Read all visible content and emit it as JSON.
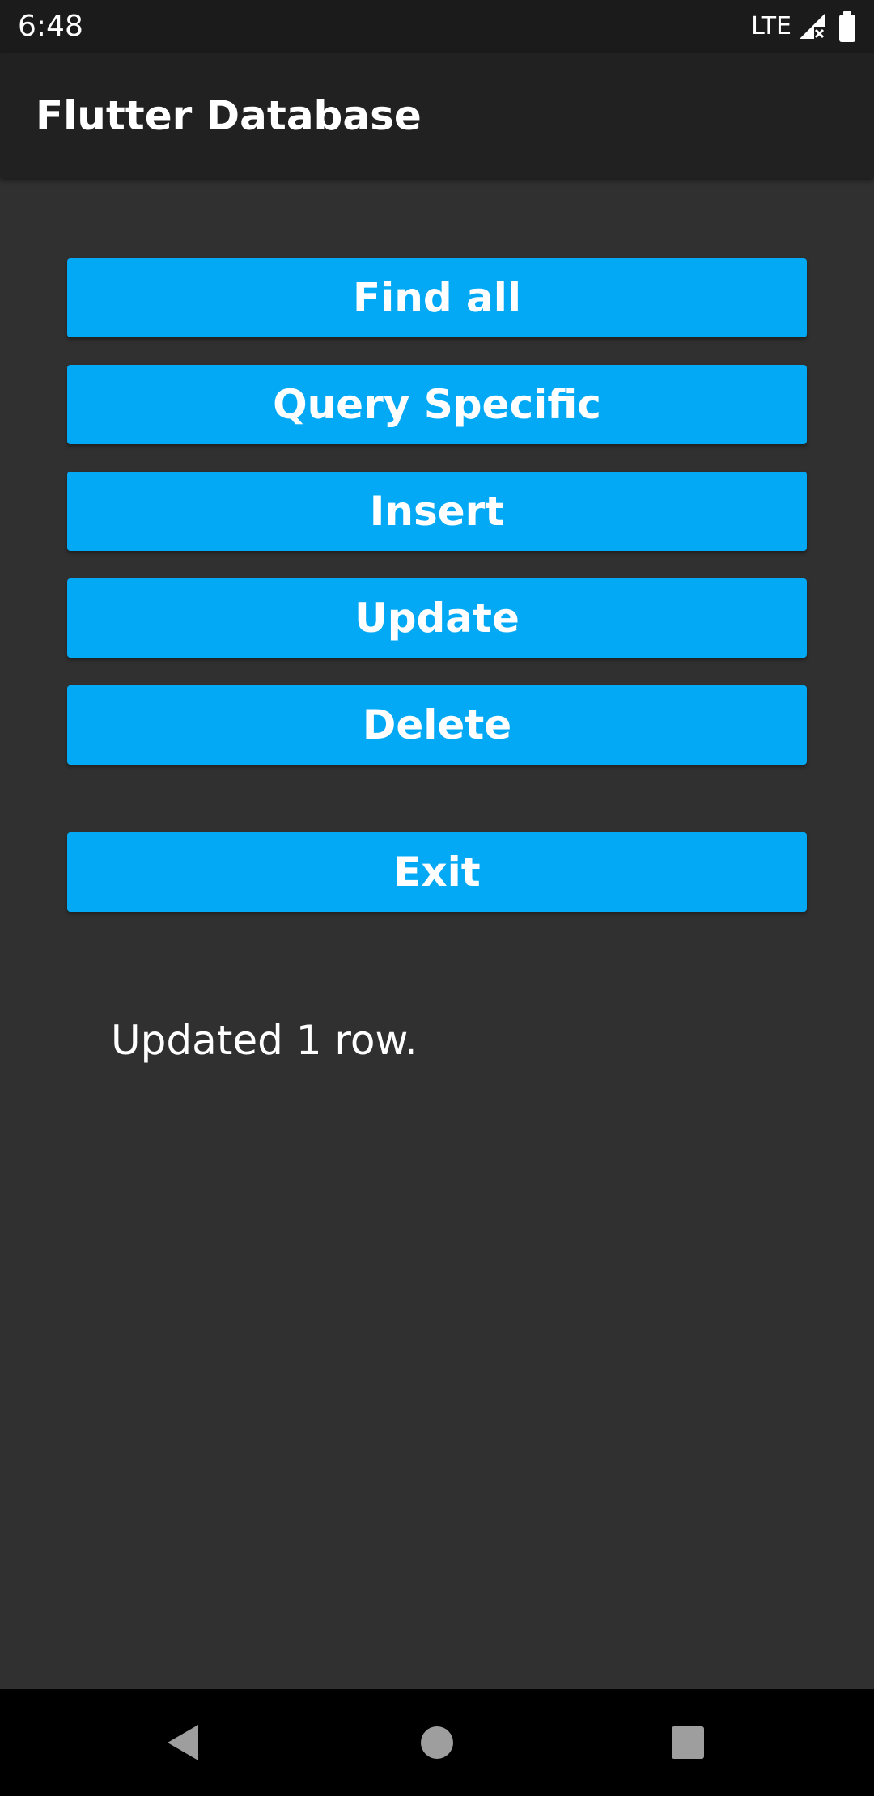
{
  "status_bar": {
    "time": "6:48",
    "network": "LTE",
    "icons": [
      "signal-no-service-icon",
      "battery-full-icon"
    ]
  },
  "app_bar": {
    "title": "Flutter Database"
  },
  "colors": {
    "button": "#03a9f4",
    "background": "#303030",
    "app_bar": "#212121",
    "status_bar": "#1b1b1b",
    "nav_bar": "#000000",
    "nav_icon": "#9e9e9e"
  },
  "buttons": [
    {
      "label": "Find all"
    },
    {
      "label": "Query Specific"
    },
    {
      "label": "Insert"
    },
    {
      "label": "Update"
    },
    {
      "label": "Delete"
    },
    {
      "label": "Exit"
    }
  ],
  "result": {
    "message": "Updated 1 row."
  },
  "nav_bar": {
    "icons": [
      "back-icon",
      "home-icon",
      "recents-icon"
    ]
  }
}
